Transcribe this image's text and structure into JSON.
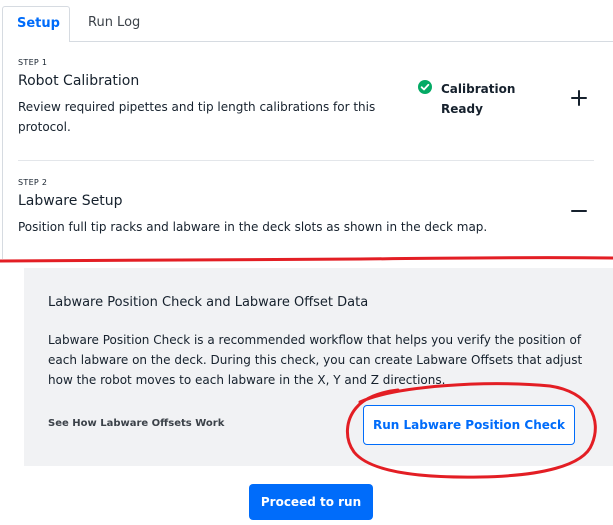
{
  "tabs": [
    {
      "label": "Setup",
      "active": true
    },
    {
      "label": "Run Log",
      "active": false
    }
  ],
  "steps": [
    {
      "step_label": "STEP 1",
      "title": "Robot Calibration",
      "description": "Review required pipettes and tip length calibrations for this protocol.",
      "status": "Calibration Ready",
      "status_icon": "check-circle-icon",
      "toggle_icon": "plus-icon"
    },
    {
      "step_label": "STEP 2",
      "title": "Labware Setup",
      "description": "Position full tip racks and labware in the deck slots as shown in the deck map.",
      "toggle_icon": "minus-icon"
    }
  ],
  "labware_position_check": {
    "title": "Labware Position Check and Labware Offset Data",
    "body": "Labware Position Check is a recommended workflow that helps you verify the position of each labware on the deck. During this check, you can create Labware Offsets that adjust how the robot moves to each labware in the X, Y and Z directions.",
    "link_label": "See How Labware Offsets Work",
    "button_label": "Run Labware Position Check"
  },
  "proceed_button_label": "Proceed to run",
  "colors": {
    "accent": "#006cfa",
    "success": "#04aa65",
    "annotation": "#e31e24",
    "panel_bg": "#f1f2f4"
  }
}
